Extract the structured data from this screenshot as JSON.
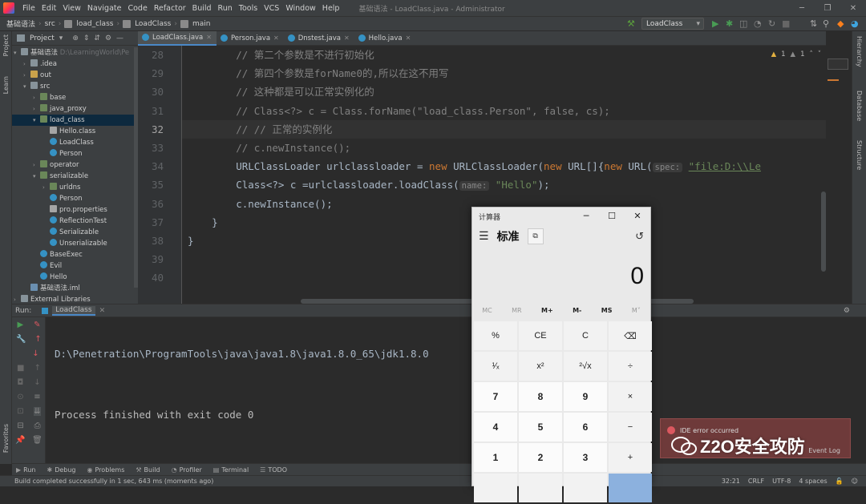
{
  "menubar": {
    "items": [
      "File",
      "Edit",
      "View",
      "Navigate",
      "Code",
      "Refactor",
      "Build",
      "Run",
      "Tools",
      "VCS",
      "Window",
      "Help"
    ],
    "window_title": "基础语法 - LoadClass.java - Administrator"
  },
  "navbar": {
    "crumbs": [
      "基础语法",
      "src",
      "load_class",
      "LoadClass",
      "main"
    ],
    "run_config": "LoadClass"
  },
  "left_strip": {
    "project": "Project",
    "learn": "Learn",
    "favorites": "Favorites"
  },
  "right_strip": {
    "hierarchy": "Hierarchy",
    "database": "Database",
    "structure": "Structure"
  },
  "project_panel": {
    "title": "Project",
    "tree": [
      {
        "label": "基础语法",
        "suffix": "D:\\LearningWorld\\Pe",
        "indent": 0,
        "arrow": "▾",
        "icon": "folder"
      },
      {
        "label": ".idea",
        "indent": 1,
        "arrow": "›",
        "icon": "folder"
      },
      {
        "label": "out",
        "indent": 1,
        "arrow": "›",
        "icon": "yellow"
      },
      {
        "label": "src",
        "indent": 1,
        "arrow": "▾",
        "icon": "folder"
      },
      {
        "label": "base",
        "indent": 2,
        "arrow": "›",
        "icon": "pkg"
      },
      {
        "label": "java_proxy",
        "indent": 2,
        "arrow": "›",
        "icon": "pkg"
      },
      {
        "label": "load_class",
        "indent": 2,
        "arrow": "▾",
        "icon": "pkg",
        "selected": true
      },
      {
        "label": "Hello.class",
        "indent": 3,
        "arrow": "",
        "icon": "prop"
      },
      {
        "label": "LoadClass",
        "indent": 3,
        "arrow": "",
        "icon": "cls"
      },
      {
        "label": "Person",
        "indent": 3,
        "arrow": "",
        "icon": "cls"
      },
      {
        "label": "operator",
        "indent": 2,
        "arrow": "›",
        "icon": "pkg"
      },
      {
        "label": "serializable",
        "indent": 2,
        "arrow": "▾",
        "icon": "pkg"
      },
      {
        "label": "urldns",
        "indent": 3,
        "arrow": "›",
        "icon": "pkg"
      },
      {
        "label": "Person",
        "indent": 3,
        "arrow": "",
        "icon": "cls"
      },
      {
        "label": "pro.properties",
        "indent": 3,
        "arrow": "",
        "icon": "prop"
      },
      {
        "label": "ReflectionTest",
        "indent": 3,
        "arrow": "",
        "icon": "cls"
      },
      {
        "label": "Serializable",
        "indent": 3,
        "arrow": "",
        "icon": "cls"
      },
      {
        "label": "Unserializable",
        "indent": 3,
        "arrow": "",
        "icon": "cls"
      },
      {
        "label": "BaseExec",
        "indent": 2,
        "arrow": "",
        "icon": "cls"
      },
      {
        "label": "Evil",
        "indent": 2,
        "arrow": "",
        "icon": "cls"
      },
      {
        "label": "Hello",
        "indent": 2,
        "arrow": "",
        "icon": "cls"
      },
      {
        "label": "基础语法.iml",
        "indent": 1,
        "arrow": "",
        "icon": "iml"
      },
      {
        "label": "External Libraries",
        "indent": 0,
        "arrow": "›",
        "icon": "folder"
      }
    ]
  },
  "editor": {
    "tabs": [
      {
        "label": "LoadClass.java",
        "active": true
      },
      {
        "label": "Person.java",
        "active": false
      },
      {
        "label": "Dnstest.java",
        "active": false
      },
      {
        "label": "Hello.java",
        "active": false
      }
    ],
    "inspection": {
      "warn1": "1",
      "warn2": "1"
    },
    "current_line": "32",
    "lines": [
      {
        "n": "28",
        "segs": [
          {
            "t": "        // 第二个参数是不进行初始化",
            "c": "cmt"
          }
        ]
      },
      {
        "n": "29",
        "segs": [
          {
            "t": "        // 第四个参数是forName0的,所以在这不用写",
            "c": "cmt"
          }
        ]
      },
      {
        "n": "30",
        "segs": [
          {
            "t": "        // 这种都是可以正常实例化的",
            "c": "cmt"
          }
        ]
      },
      {
        "n": "31",
        "segs": [
          {
            "t": "        // Class<?> c = Class.forName(\"load_class.Person\", false, cs);",
            "c": "cmt"
          }
        ]
      },
      {
        "n": "32",
        "segs": [
          {
            "t": "        // // 正常的实例化",
            "c": "cmt"
          }
        ]
      },
      {
        "n": "33",
        "segs": [
          {
            "t": "        // c.newInstance();",
            "c": "cmt"
          }
        ]
      },
      {
        "n": "34",
        "segs": [
          {
            "t": "        URLClassLoader urlclassloader = ",
            "c": ""
          },
          {
            "t": "new",
            "c": "kw"
          },
          {
            "t": " URLClassLoader(",
            "c": ""
          },
          {
            "t": "new",
            "c": "kw"
          },
          {
            "t": " URL[]{",
            "c": ""
          },
          {
            "t": "new",
            "c": "kw"
          },
          {
            "t": " URL(",
            "c": ""
          },
          {
            "t": "spec:",
            "c": "hint"
          },
          {
            "t": " ",
            "c": ""
          },
          {
            "t": "\"file:D:\\\\Le",
            "c": "strl"
          }
        ]
      },
      {
        "n": "35",
        "segs": [
          {
            "t": "        Class<?> c =urlclassloader.loadClass(",
            "c": ""
          },
          {
            "t": "name:",
            "c": "hint"
          },
          {
            "t": " ",
            "c": ""
          },
          {
            "t": "\"Hello\"",
            "c": "str"
          },
          {
            "t": ");",
            "c": ""
          }
        ]
      },
      {
        "n": "36",
        "segs": [
          {
            "t": "        c.newInstance();",
            "c": ""
          }
        ]
      },
      {
        "n": "37",
        "segs": [
          {
            "t": "    }",
            "c": ""
          }
        ]
      },
      {
        "n": "38",
        "segs": [
          {
            "t": "}",
            "c": ""
          }
        ]
      },
      {
        "n": "39",
        "segs": []
      },
      {
        "n": "40",
        "segs": []
      }
    ]
  },
  "run_panel": {
    "label": "Run:",
    "tab": "LoadClass",
    "path_line": "D:\\Penetration\\ProgramTools\\java\\java1.8\\java1.8.0_65\\jdk1.8.0",
    "finish_line": "Process finished with exit code 0"
  },
  "bottom_tabs": [
    "Run",
    "Debug",
    "Problems",
    "Build",
    "Profiler",
    "Terminal",
    "TODO"
  ],
  "status": {
    "message": "Build completed successfully in 1 sec, 643 ms (moments ago)",
    "position": "32:21",
    "line_sep": "CRLF",
    "encoding": "UTF-8",
    "indent": "4 spaces",
    "event_log": "Event Log"
  },
  "calculator": {
    "title": "计算器",
    "mode": "标准",
    "display": "0",
    "memory": [
      "MC",
      "MR",
      "M+",
      "M-",
      "MS",
      "M˅"
    ],
    "memory_enabled": [
      false,
      false,
      true,
      true,
      true,
      false
    ],
    "keys": [
      "%",
      "CE",
      "C",
      "⌫",
      "¹⁄ₓ",
      "x²",
      "²√x",
      "÷",
      "7",
      "8",
      "9",
      "×",
      "4",
      "5",
      "6",
      "−",
      "1",
      "2",
      "3",
      "+",
      "",
      "",
      "",
      ""
    ],
    "numeric": [
      false,
      false,
      false,
      false,
      false,
      false,
      false,
      false,
      true,
      true,
      true,
      false,
      true,
      true,
      true,
      false,
      true,
      true,
      true,
      false,
      false,
      false,
      false,
      false
    ]
  },
  "notification": {
    "text": "IDE error occurred"
  },
  "watermark": "Z2O安全攻防",
  "colors": {
    "bg": "#2b2b2b",
    "panel": "#3c3f41",
    "comment": "#808080",
    "keyword": "#cc7832",
    "string": "#6a8759",
    "accent": "#4a88c7"
  }
}
